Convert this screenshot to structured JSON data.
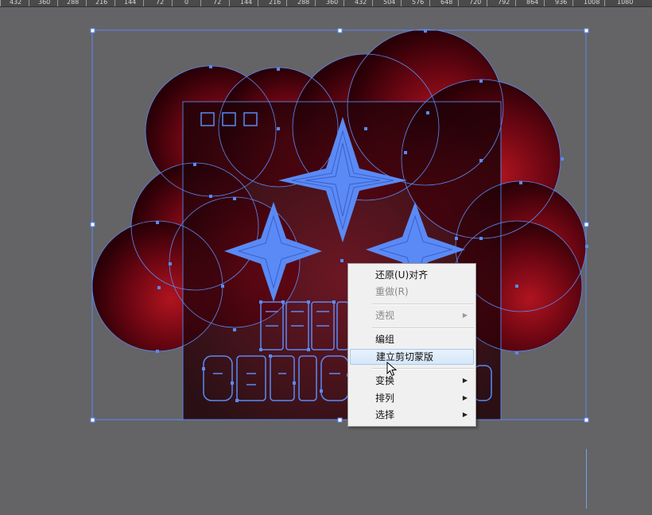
{
  "ruler": {
    "labels": [
      "432",
      "360",
      "288",
      "216",
      "144",
      "72",
      "0",
      "72",
      "144",
      "216",
      "288",
      "360",
      "432",
      "504",
      "576",
      "648",
      "720",
      "792",
      "864",
      "936",
      "1008",
      "1080"
    ]
  },
  "artwork": {
    "selection_color": "#5a8af5",
    "bubble_center_color": "#b0141f",
    "bubble_edge_color": "#2a0006",
    "panel_color": "#2b0710",
    "star_color": "#5a8af5",
    "text_outline_rows": [
      "MERRY",
      "CHRISTMAS"
    ]
  },
  "context_menu": {
    "items": [
      {
        "label": "还原(U)对齐",
        "enabled": true,
        "submenu": false
      },
      {
        "label": "重做(R)",
        "enabled": false,
        "submenu": false
      },
      {
        "label": "透视",
        "enabled": false,
        "submenu": true
      },
      {
        "label": "编组",
        "enabled": true,
        "submenu": false
      },
      {
        "label": "建立剪切蒙版",
        "enabled": true,
        "submenu": false,
        "highlighted": true
      },
      {
        "label": "变换",
        "enabled": true,
        "submenu": true
      },
      {
        "label": "排列",
        "enabled": true,
        "submenu": true
      },
      {
        "label": "选择",
        "enabled": true,
        "submenu": true
      }
    ],
    "submenu_arrow_icon": "triangle-right-icon"
  },
  "cursor": {
    "icon": "arrow-pointer-icon"
  }
}
